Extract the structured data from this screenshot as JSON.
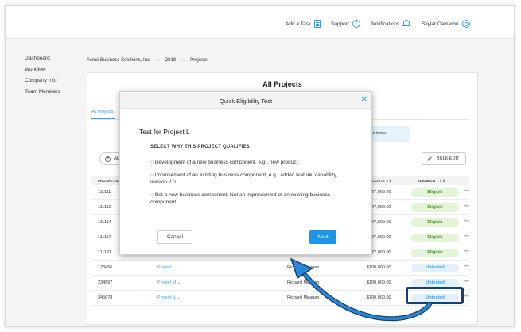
{
  "topbar": {
    "add_task": "Add a Task",
    "support": "Support",
    "notifications": "Notifications",
    "user": "Skylar Cameron"
  },
  "sidebar": {
    "items": [
      "Dashboard",
      "Workflow",
      "Company Info",
      "Team Members"
    ]
  },
  "breadcrumb": {
    "company": "Acme Business Solutions, Inc.",
    "sep": "→",
    "year": "2018",
    "page": "Projects"
  },
  "panel": {
    "title": "All Projects",
    "tab": "All Projects",
    "banner": "the tests.",
    "add_label": "AD",
    "bulk_edit": "BULK EDIT"
  },
  "table": {
    "headers": {
      "project_id": "PROJECT ID",
      "costs": "AL COSTS ⇧⇩",
      "eligibility": "ELIGIBILITY ⇧⇩"
    },
    "rows": [
      {
        "id": "111111",
        "project": "",
        "owner": "",
        "cost": "$127,000.00",
        "status": "Eligible"
      },
      {
        "id": "111112",
        "project": "",
        "owner": "",
        "cost": "$127,000.00",
        "status": "Eligible"
      },
      {
        "id": "111114",
        "project": "",
        "owner": "",
        "cost": "$127,000.00",
        "status": "Eligible"
      },
      {
        "id": "111117",
        "project": "",
        "owner": "",
        "cost": "$127,000.00",
        "status": "Eligible"
      },
      {
        "id": "111121",
        "project": "",
        "owner": "",
        "cost": "$127,000.00",
        "status": "Eligible"
      },
      {
        "id": "123456",
        "project": "Project L ⌄",
        "owner": "Richard Meagan",
        "cost": "$100,000.00",
        "status": "Untested"
      },
      {
        "id": "234567",
        "project": "Project M ⌄",
        "owner": "Richard Meagan",
        "cost": "$100,000.00",
        "status": "Untested"
      },
      {
        "id": "345678",
        "project": "Project N ⌄",
        "owner": "Richard Meagan",
        "cost": "$100,000.00",
        "status": "Untested"
      }
    ],
    "more": "•••"
  },
  "modal": {
    "title": "Quick Eligibility Test",
    "close": "✕",
    "heading": "Test for Project L",
    "subhead": "SELECT WHY THIS PROJECT QUALIFIES",
    "options": [
      "○ Development of a new business component, e.g., new product.",
      "○ Improvement of an existing business component, e.g., added feature, capability, version 2.0.",
      "○ Not a new business component. Not an improvement of an existing business component."
    ],
    "cancel": "Cancel",
    "next": "Next"
  },
  "colors": {
    "accent": "#1d95e6",
    "highlight": "#17426e",
    "eligible_bg": "#e5f3d9",
    "untested_bg": "#e3f0fa"
  }
}
